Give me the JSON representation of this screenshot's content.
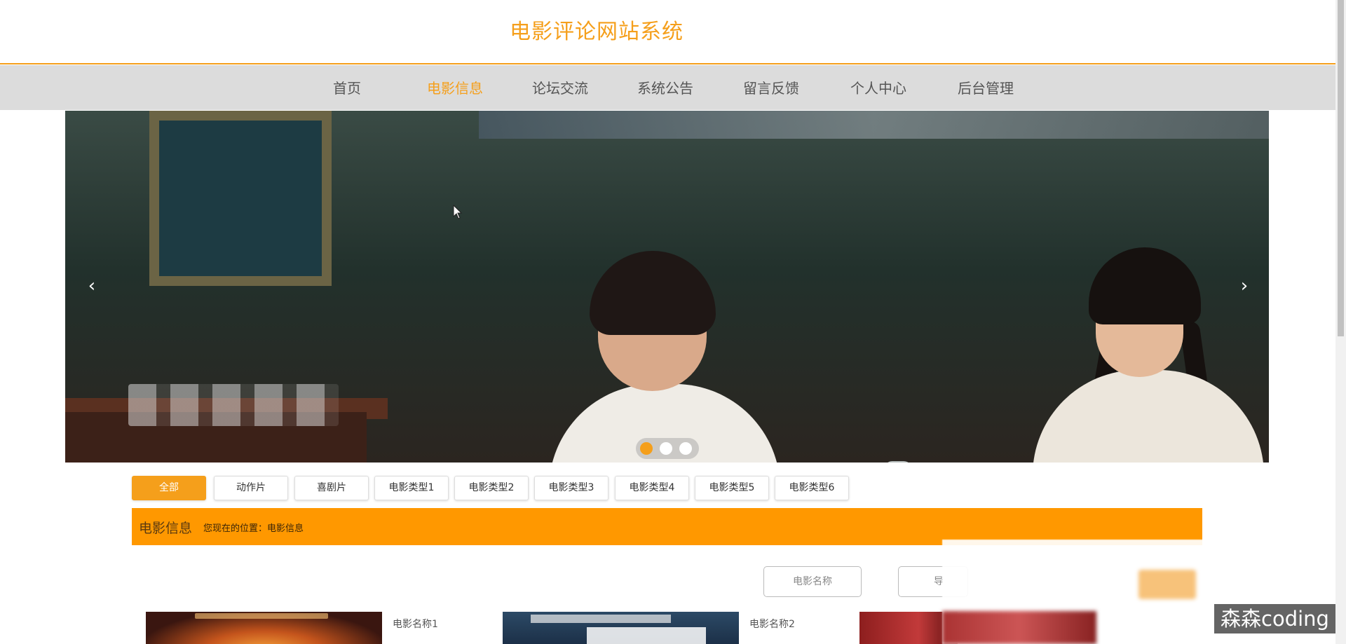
{
  "site": {
    "title": "电影评论网站系统"
  },
  "nav": {
    "items": [
      {
        "label": "首页"
      },
      {
        "label": "电影信息"
      },
      {
        "label": "论坛交流"
      },
      {
        "label": "系统公告"
      },
      {
        "label": "留言反馈"
      },
      {
        "label": "个人中心"
      },
      {
        "label": "后台管理"
      }
    ],
    "active_index": 1
  },
  "carousel": {
    "prev_icon": "chevron-left-icon",
    "next_icon": "chevron-right-icon",
    "prev_glyph": "‹",
    "next_glyph": "›",
    "slide_count": 3,
    "active_slide": 1
  },
  "categories": [
    {
      "label": "全部"
    },
    {
      "label": "动作片"
    },
    {
      "label": "喜剧片"
    },
    {
      "label": "电影类型1"
    },
    {
      "label": "电影类型2"
    },
    {
      "label": "电影类型3"
    },
    {
      "label": "电影类型4"
    },
    {
      "label": "电影类型5"
    },
    {
      "label": "电影类型6"
    }
  ],
  "breadcrumb": {
    "title": "电影信息",
    "path": "您现在的位置：电影信息"
  },
  "search": {
    "name_placeholder": "电影名称",
    "second_placeholder": "导"
  },
  "movies": [
    {
      "name": "电影名称1"
    },
    {
      "name": "电影名称2"
    }
  ],
  "watermark": "森森coding",
  "colors": {
    "accent": "#f59f1b",
    "crumb_bar": "#ff9800",
    "nav_bg": "#dcdcdc"
  }
}
